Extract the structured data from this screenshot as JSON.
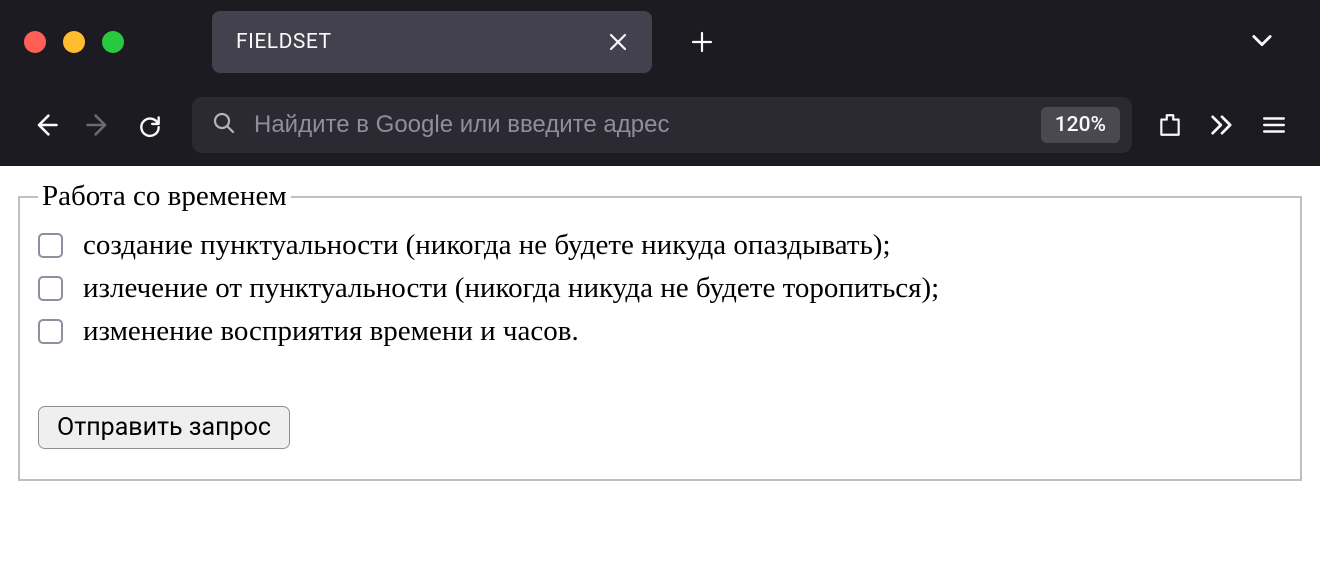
{
  "browser": {
    "tab_title": "FIELDSET",
    "address_placeholder": "Найдите в Google или введите адрес",
    "zoom_level": "120%"
  },
  "form": {
    "legend": "Работа со временем",
    "options": [
      "создание пунктуальности (никогда не будете никуда опаздывать);",
      "излечение от пунктуальности (никогда никуда не будете торопиться);",
      "изменение восприятия времени и часов."
    ],
    "submit_label": "Отправить запрос"
  }
}
